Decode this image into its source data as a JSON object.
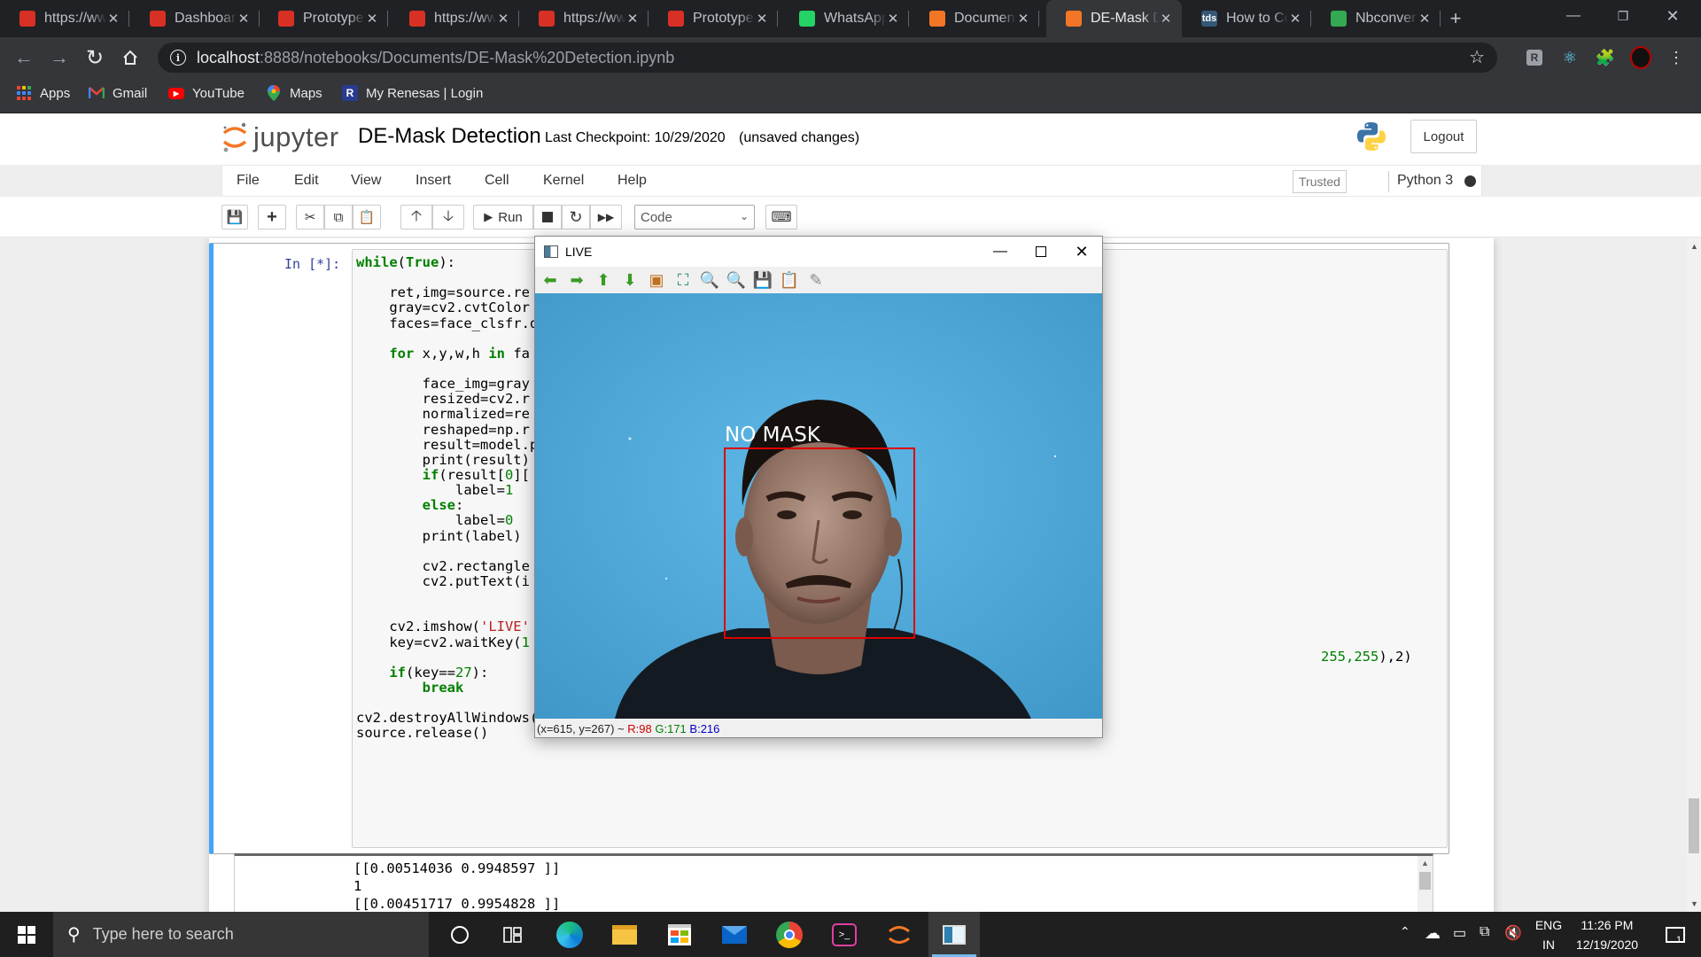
{
  "browser": {
    "tabs": [
      {
        "title": "https://www.",
        "favicon": "pdf-icon",
        "color": "#d93025"
      },
      {
        "title": "Dashboard",
        "favicon": "pdf-icon",
        "color": "#d93025"
      },
      {
        "title": "Prototype",
        "favicon": "pdf-icon",
        "color": "#d93025"
      },
      {
        "title": "https://www.",
        "favicon": "pdf-icon",
        "color": "#d93025"
      },
      {
        "title": "https://www.",
        "favicon": "pdf-icon",
        "color": "#d93025"
      },
      {
        "title": "Prototype",
        "favicon": "pdf-icon",
        "color": "#d93025"
      },
      {
        "title": "WhatsApp",
        "favicon": "whatsapp-icon",
        "color": "#25d366"
      },
      {
        "title": "Document",
        "favicon": "jupyter-icon",
        "color": "#f37626"
      },
      {
        "title": "DE-Mask Detection",
        "favicon": "hourglass-icon",
        "color": "#f37626",
        "active": true
      },
      {
        "title": "How to Convert",
        "favicon": "tds-icon",
        "color": "#355876",
        "label": "tds"
      },
      {
        "title": "Nbconvert",
        "favicon": "loading-icon",
        "color": "#34a853"
      }
    ],
    "new_tab_symbol": "+",
    "url_host": "localhost",
    "url_path": ":8888/notebooks/Documents/DE-Mask%20Detection.ipynb",
    "bookmarks": [
      {
        "label": "Apps",
        "icon": "apps-grid-icon"
      },
      {
        "label": "Gmail",
        "icon": "gmail-icon"
      },
      {
        "label": "YouTube",
        "icon": "youtube-icon"
      },
      {
        "label": "Maps",
        "icon": "maps-pin-icon"
      },
      {
        "label": "My Renesas | Login",
        "icon": "renesas-icon"
      }
    ]
  },
  "jupyter": {
    "logo_text": "jupyter",
    "notebook_name": "DE-Mask Detection",
    "checkpoint": "Last Checkpoint: 10/29/2020",
    "unsaved": "(unsaved changes)",
    "logout_label": "Logout",
    "menus": [
      "File",
      "Edit",
      "View",
      "Insert",
      "Cell",
      "Kernel",
      "Help"
    ],
    "trusted_label": "Trusted",
    "kernel_name": "Python 3",
    "run_label": "Run",
    "cell_type": "Code"
  },
  "cell": {
    "prompt": "In [*]:",
    "code_lines": [
      [
        {
          "t": "while",
          "c": "kw"
        },
        {
          "t": "(",
          "c": ""
        },
        {
          "t": "True",
          "c": "kw"
        },
        {
          "t": "):",
          "c": ""
        }
      ],
      [],
      [
        {
          "t": "    ret,img=source.re",
          "c": ""
        }
      ],
      [
        {
          "t": "    gray=cv2.cvtColor",
          "c": ""
        }
      ],
      [
        {
          "t": "    faces=face_clsfr.d",
          "c": ""
        }
      ],
      [],
      [
        {
          "t": "    ",
          "c": ""
        },
        {
          "t": "for",
          "c": "kw"
        },
        {
          "t": " x,y,w,h ",
          "c": ""
        },
        {
          "t": "in",
          "c": "kw"
        },
        {
          "t": " fa",
          "c": ""
        }
      ],
      [],
      [
        {
          "t": "        face_img=gray",
          "c": ""
        }
      ],
      [
        {
          "t": "        resized=cv2.r",
          "c": ""
        }
      ],
      [
        {
          "t": "        normalized=re",
          "c": ""
        }
      ],
      [
        {
          "t": "        reshaped=np.r",
          "c": ""
        }
      ],
      [
        {
          "t": "        result=model.p",
          "c": ""
        }
      ],
      [
        {
          "t": "        print(result)",
          "c": ""
        }
      ],
      [
        {
          "t": "        ",
          "c": ""
        },
        {
          "t": "if",
          "c": "kw"
        },
        {
          "t": "(result[",
          "c": ""
        },
        {
          "t": "0",
          "c": "num"
        },
        {
          "t": "][",
          "c": ""
        }
      ],
      [
        {
          "t": "            label=",
          "c": ""
        },
        {
          "t": "1",
          "c": "num"
        }
      ],
      [
        {
          "t": "        ",
          "c": ""
        },
        {
          "t": "else",
          "c": "kw"
        },
        {
          "t": ":",
          "c": ""
        }
      ],
      [
        {
          "t": "            label=",
          "c": ""
        },
        {
          "t": "0",
          "c": "num"
        }
      ],
      [
        {
          "t": "        print(label)",
          "c": ""
        }
      ],
      [],
      [
        {
          "t": "        cv2.rectangle",
          "c": ""
        }
      ],
      [
        {
          "t": "        cv2.putText(i",
          "c": ""
        }
      ],
      [],
      [],
      [
        {
          "t": "    cv2.imshow(",
          "c": ""
        },
        {
          "t": "'LIVE'",
          "c": "str"
        }
      ],
      [
        {
          "t": "    key=cv2.waitKey(",
          "c": ""
        },
        {
          "t": "1",
          "c": "num"
        }
      ],
      [],
      [
        {
          "t": "    ",
          "c": ""
        },
        {
          "t": "if",
          "c": "kw"
        },
        {
          "t": "(key==",
          "c": ""
        },
        {
          "t": "27",
          "c": "num"
        },
        {
          "t": "):",
          "c": ""
        }
      ],
      [
        {
          "t": "        ",
          "c": ""
        },
        {
          "t": "break",
          "c": "kw"
        }
      ],
      [],
      [
        {
          "t": "cv2.destroyAllWindows()",
          "c": ""
        }
      ],
      [
        {
          "t": "source.release()",
          "c": ""
        }
      ]
    ],
    "puttext_tail_num": "255,255",
    "puttext_tail_rest": "),2)",
    "output_lines": [
      "[[0.00514036 0.9948597 ]]",
      "1",
      "[[0.00451717 0.9954828 ]]"
    ]
  },
  "cv_window": {
    "title": "LIVE",
    "tools": [
      {
        "icon": "arrow-left-icon",
        "glyph": "⬅",
        "color": "#3a9a25"
      },
      {
        "icon": "arrow-right-icon",
        "glyph": "➡",
        "color": "#3a9a25"
      },
      {
        "icon": "arrow-up-icon",
        "glyph": "⬆",
        "color": "#3a9a25"
      },
      {
        "icon": "arrow-down-icon",
        "glyph": "⬇",
        "color": "#3a9a25"
      },
      {
        "icon": "image-icon",
        "glyph": "▣",
        "color": "#c07020"
      },
      {
        "icon": "zoom-fit-icon",
        "glyph": "⛶",
        "color": "#2a8a60"
      },
      {
        "icon": "zoom-in-icon",
        "glyph": "🔍",
        "color": "#2a7a3a"
      },
      {
        "icon": "zoom-out-icon",
        "glyph": "🔍",
        "color": "#2a7a3a"
      },
      {
        "icon": "save-icon",
        "glyph": "💾",
        "color": "#3a8a30"
      },
      {
        "icon": "copy-icon",
        "glyph": "📋",
        "color": "#c08020"
      },
      {
        "icon": "properties-icon",
        "glyph": "✎",
        "color": "#888"
      }
    ],
    "overlay_label": "NO MASK",
    "box_color": "#e00000",
    "status_coords": "(x=615, y=267) ~",
    "status_r": "R:98",
    "status_g": "G:171",
    "status_b": "B:216"
  },
  "taskbar": {
    "search_placeholder": "Type here to search",
    "pinned": [
      "cortana-icon",
      "task-view-icon",
      "edge-icon",
      "file-explorer-icon",
      "store-icon",
      "mail-icon",
      "chrome-icon",
      "terminal-icon",
      "jupyter-icon",
      "python-window-icon"
    ],
    "lang_top": "ENG",
    "lang_bottom": "IN",
    "time": "11:26 PM",
    "date": "12/19/2020",
    "notification_count": "1"
  }
}
